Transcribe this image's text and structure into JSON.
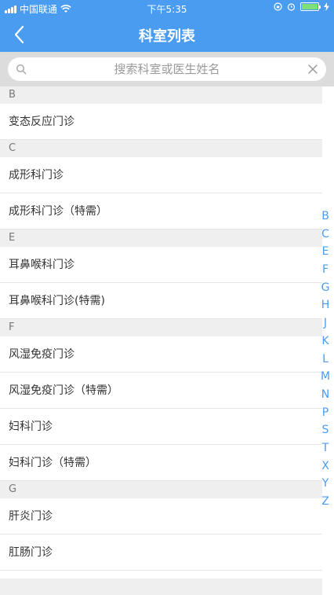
{
  "status_bar": {
    "carrier": "中国联通",
    "time": "下午5:35"
  },
  "nav": {
    "title": "科室列表"
  },
  "search": {
    "placeholder": "搜索科室或医生姓名"
  },
  "sections": [
    {
      "letter": "B",
      "items": [
        "变态反应门诊"
      ]
    },
    {
      "letter": "C",
      "items": [
        "成形科门诊",
        "成形科门诊（特需）"
      ]
    },
    {
      "letter": "E",
      "items": [
        "耳鼻喉科门诊",
        "耳鼻喉科门诊(特需)"
      ]
    },
    {
      "letter": "F",
      "items": [
        "风湿免疫门诊",
        "风湿免疫门诊（特需）",
        "妇科门诊",
        "妇科门诊（特需）"
      ]
    },
    {
      "letter": "G",
      "items": [
        "肝炎门诊",
        "肛肠门诊"
      ]
    }
  ],
  "index_letters": [
    "B",
    "C",
    "E",
    "F",
    "G",
    "H",
    "J",
    "K",
    "L",
    "M",
    "N",
    "P",
    "S",
    "T",
    "X",
    "Y",
    "Z"
  ],
  "colors": {
    "primary": "#4a9cf0",
    "section_bg": "#efefef",
    "search_bg": "#dcdcdc"
  },
  "icons": {
    "back": "chevron-left-icon",
    "search": "search-icon",
    "clear": "close-icon",
    "wifi": "wifi-icon",
    "battery": "battery-icon"
  }
}
